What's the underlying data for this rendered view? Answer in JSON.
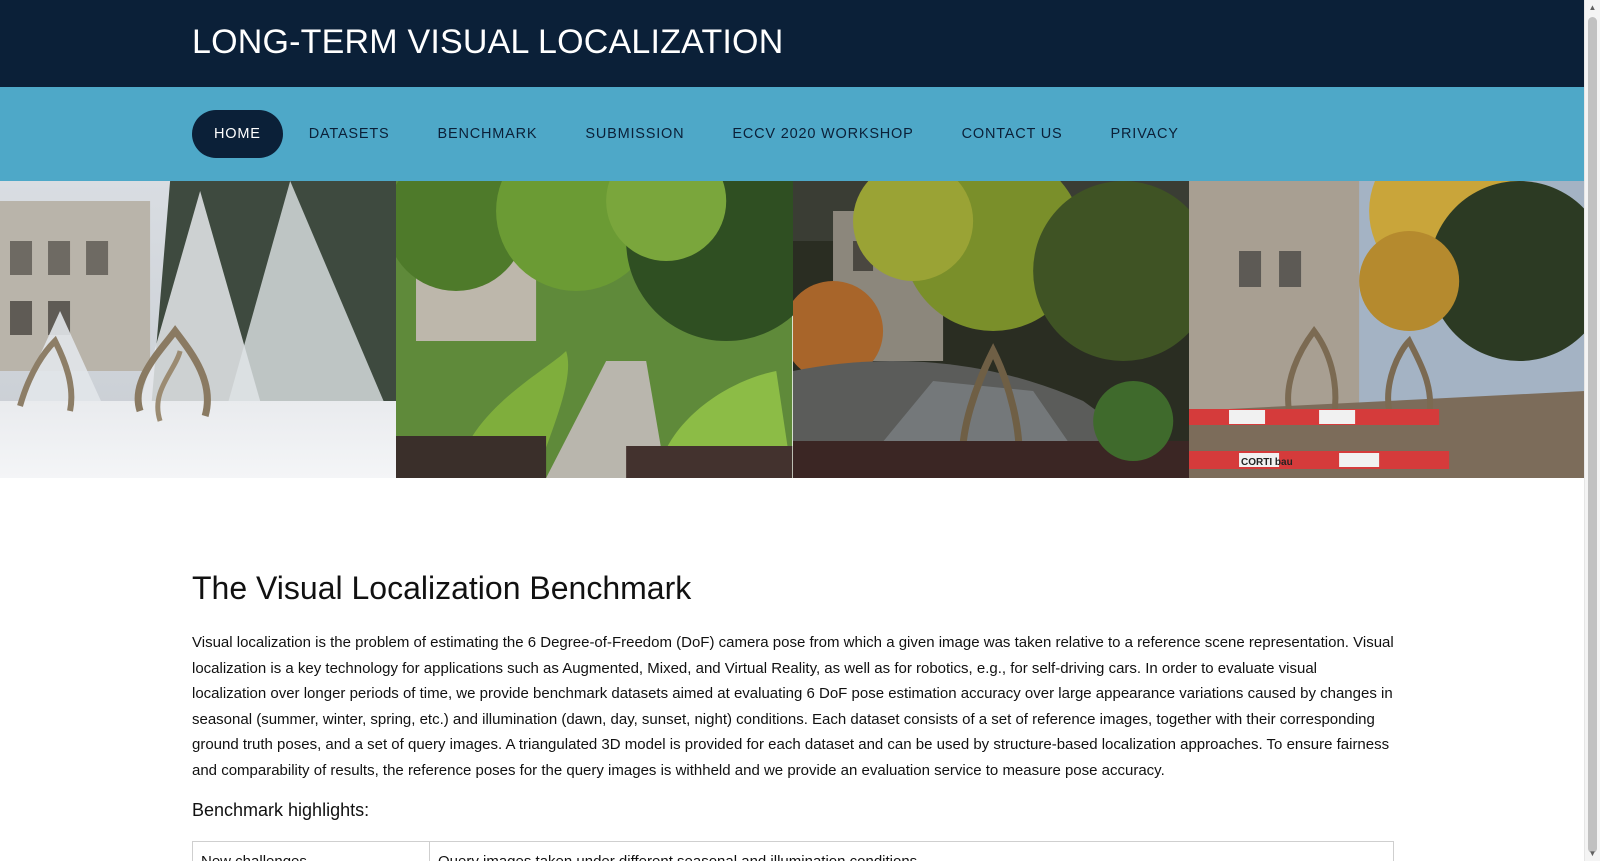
{
  "site": {
    "title": "LONG-TERM VISUAL LOCALIZATION"
  },
  "nav": {
    "items": [
      {
        "label": "HOME",
        "active": true
      },
      {
        "label": "DATASETS",
        "active": false
      },
      {
        "label": "BENCHMARK",
        "active": false
      },
      {
        "label": "SUBMISSION",
        "active": false
      },
      {
        "label": "ECCV 2020 WORKSHOP",
        "active": false
      },
      {
        "label": "CONTACT US",
        "active": false
      },
      {
        "label": "PRIVACY",
        "active": false
      }
    ]
  },
  "banner": {
    "panels": [
      {
        "scene": "winter-snow",
        "sign_text": ""
      },
      {
        "scene": "summer-garden",
        "sign_text": ""
      },
      {
        "scene": "autumn-night",
        "sign_text": ""
      },
      {
        "scene": "autumn-day-barrier",
        "sign_text": "CORTI bau"
      }
    ]
  },
  "article": {
    "heading": "The Visual Localization Benchmark",
    "intro": "Visual localization is the problem of estimating the 6 Degree-of-Freedom (DoF) camera pose from which a given image was taken relative to a reference scene representation. Visual localization is a key technology for applications such as Augmented, Mixed, and Virtual Reality, as well as for robotics, e.g., for self-driving cars. In order to evaluate visual localization over longer periods of time, we provide benchmark datasets aimed at evaluating 6 DoF pose estimation accuracy over large appearance variations caused by changes in seasonal (summer, winter, spring, etc.) and illumination (dawn, day, sunset, night) conditions. Each dataset consists of a set of reference images, together with their corresponding ground truth poses, and a set of query images. A triangulated 3D model is provided for each dataset and can be used by structure-based localization approaches. To ensure fairness and comparability of results, the reference poses for the query images is withheld and we provide an evaluation service to measure pose accuracy.",
    "highlights_heading": "Benchmark highlights:",
    "highlights": [
      {
        "key": "New challenges",
        "value": "Query images taken under different seasonal and illumination conditions"
      }
    ]
  },
  "colors": {
    "topbar": "#0b2038",
    "navbar": "#4ea8c8",
    "active_tab": "#0b2038"
  },
  "icons": {
    "scroll_up": "scroll-up-arrow-icon",
    "scroll_down": "scroll-down-arrow-icon"
  }
}
